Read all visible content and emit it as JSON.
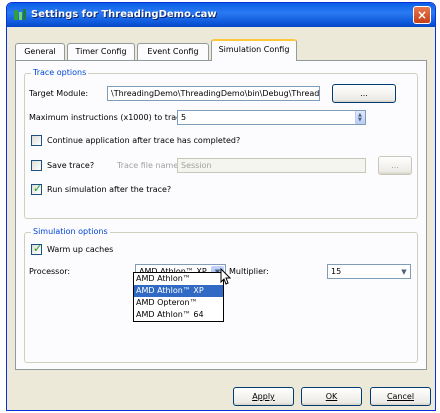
{
  "window": {
    "title": "Settings for ThreadingDemo.caw",
    "close_glyph": "×"
  },
  "tabs": [
    {
      "label": "General"
    },
    {
      "label": "Timer Config"
    },
    {
      "label": "Event Config"
    },
    {
      "label": "Simulation Config"
    }
  ],
  "trace": {
    "group_title": "Trace options",
    "target_module_label": "Target Module:",
    "target_module_value": "\\ThreadingDemo\\ThreadingDemo\\bin\\Debug\\ThreadingDemo.exe",
    "browse_label": "...",
    "max_instr_label": "Maximum instructions (x1000) to trace:",
    "max_instr_value": "5",
    "continue_label": "Continue application after trace has completed?",
    "continue_checked": false,
    "save_label": "Save trace?",
    "save_checked": false,
    "trace_file_label": "Trace file name:",
    "trace_file_value": "Session",
    "trace_browse_label": "...",
    "run_sim_label": "Run simulation after the trace?",
    "run_sim_checked": true
  },
  "sim": {
    "group_title": "Simulation options",
    "warmup_label": "Warm up caches",
    "warmup_checked": true,
    "processor_label": "Processor:",
    "processor_value": "AMD Athlon™ XP",
    "multiplier_label": "Multiplier:",
    "multiplier_value": "15",
    "processor_options": [
      "AMD Athlon™",
      "AMD Athlon™ XP",
      "AMD Opteron™",
      "AMD Athlon™ 64"
    ],
    "selected_option_index": 1
  },
  "footer": {
    "apply_label": "Apply",
    "ok_label": "OK",
    "cancel_label": "Cancel"
  },
  "colors": {
    "accent": "#0046d5",
    "selection": "#316ac5",
    "titlebar": "#0a5fe6"
  },
  "icons": {
    "app": "app-icon",
    "close": "close-icon",
    "check": "checkmark-icon",
    "dropdown": "chevron-down-icon",
    "cursor": "mouse-pointer-icon"
  }
}
